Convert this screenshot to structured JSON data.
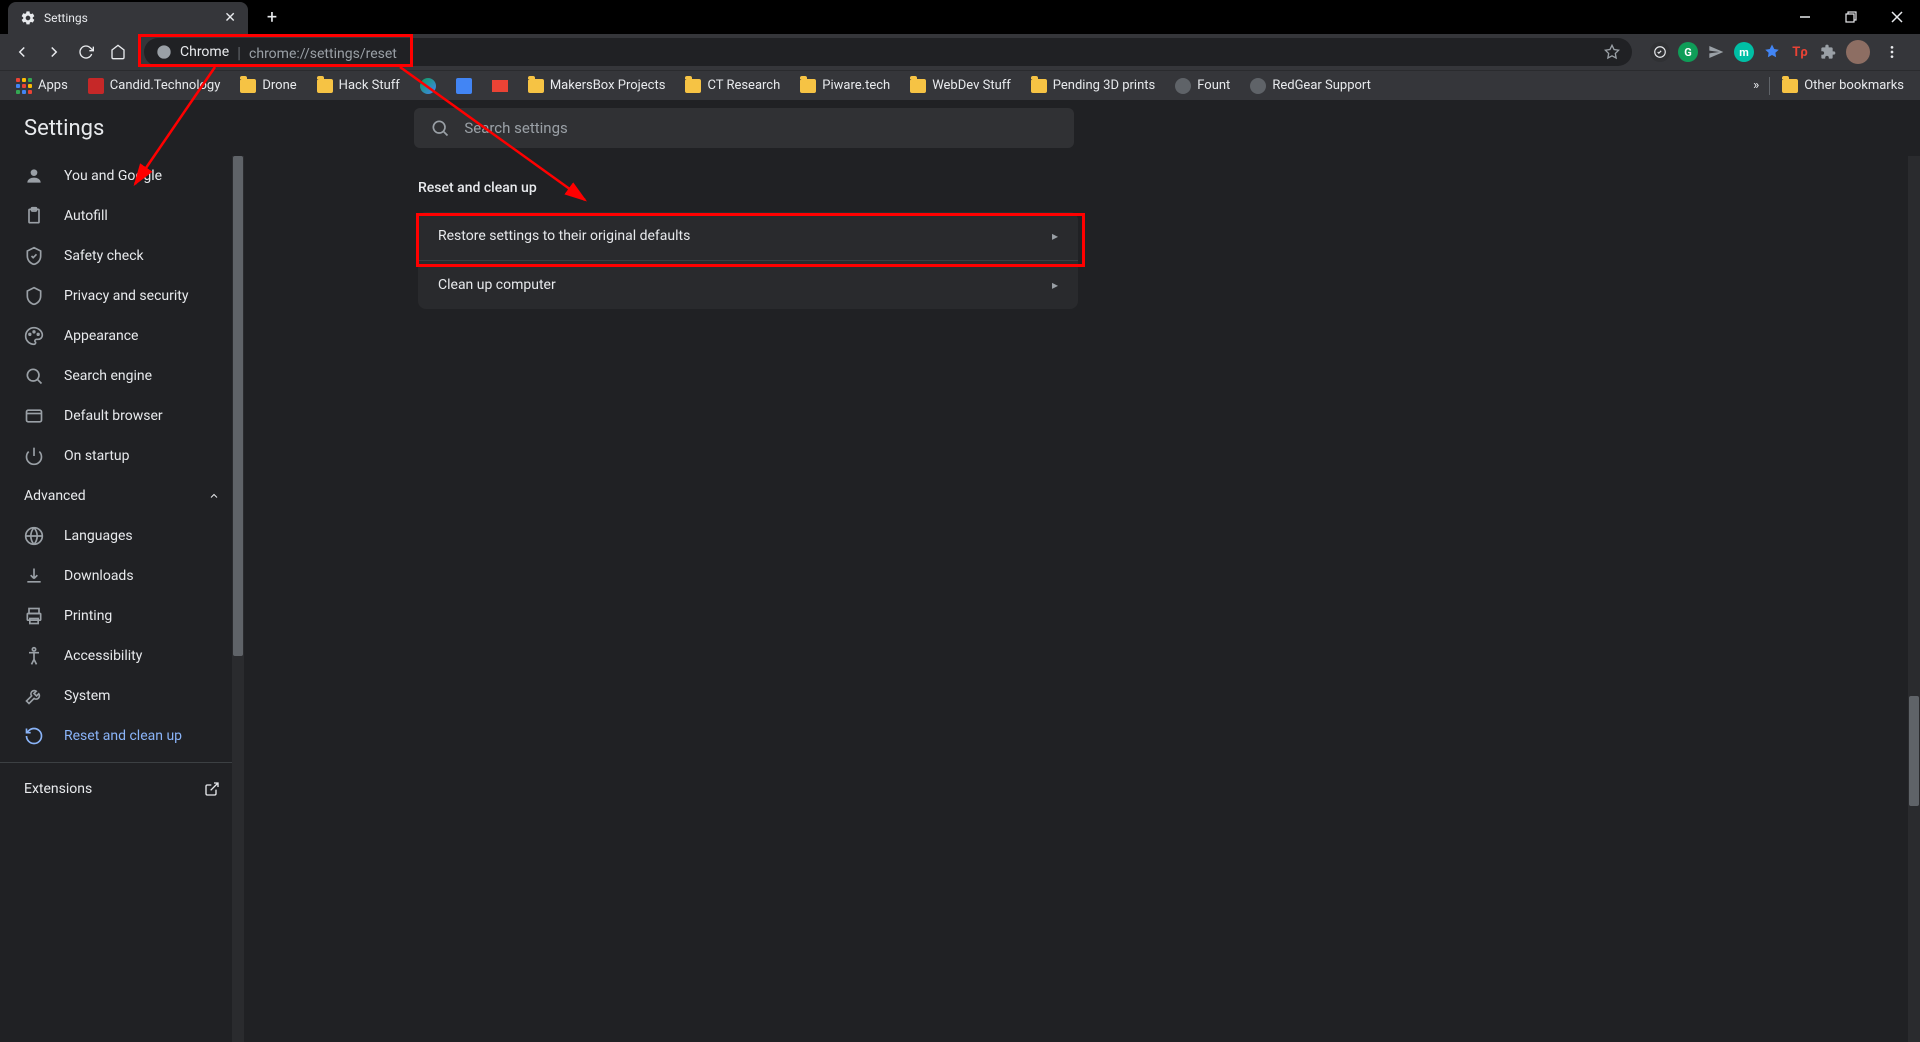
{
  "tab": {
    "title": "Settings"
  },
  "omnibox": {
    "chip": "Chrome",
    "url_host": "chrome://settings",
    "url_path": "/reset"
  },
  "bookmarks": {
    "apps": "Apps",
    "items": [
      "Candid.Technology",
      "Drone",
      "Hack Stuff",
      "MakersBox Projects",
      "CT Research",
      "Piware.tech",
      "WebDev Stuff",
      "Pending 3D prints",
      "Fount",
      "RedGear Support"
    ],
    "overflow": "»",
    "other": "Other bookmarks"
  },
  "settings": {
    "title": "Settings",
    "search_placeholder": "Search settings",
    "nav": {
      "basic": [
        "You and Google",
        "Autofill",
        "Safety check",
        "Privacy and security",
        "Appearance",
        "Search engine",
        "Default browser",
        "On startup"
      ],
      "advanced_label": "Advanced",
      "advanced": [
        "Languages",
        "Downloads",
        "Printing",
        "Accessibility",
        "System",
        "Reset and clean up"
      ],
      "extensions": "Extensions"
    },
    "section": {
      "title": "Reset and clean up",
      "rows": [
        "Restore settings to their original defaults",
        "Clean up computer"
      ]
    }
  }
}
